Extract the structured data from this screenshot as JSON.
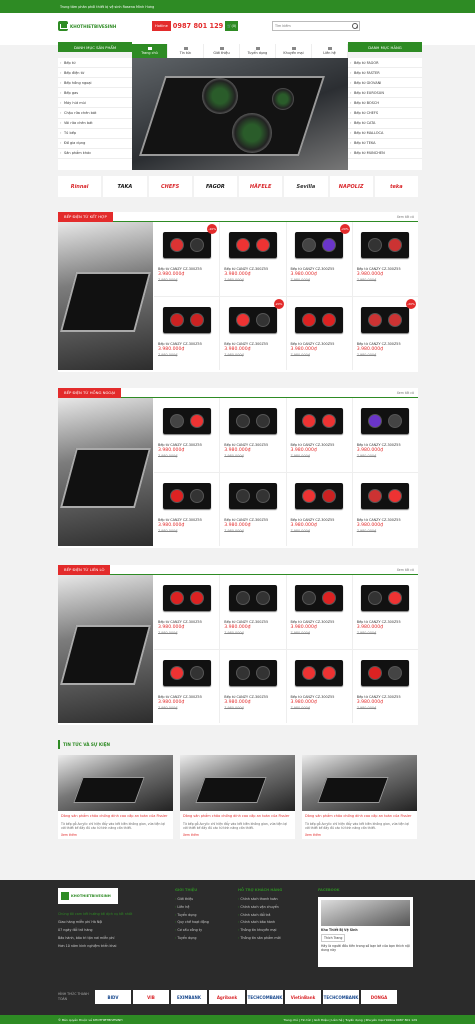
{
  "topbar": {
    "text": "Trung tâm phân phối thiết bị vệ sinh Rosena Minh Hưng"
  },
  "header": {
    "logo": "KHOTHIETBIVESINH",
    "hotline_label": "Hotline",
    "hotline_number": "0987 801 129",
    "cart_count": "(0)",
    "search_placeholder": "Tìm kiếm"
  },
  "nav": {
    "left_title": "DANH MỤC SẢN PHẨM",
    "right_title": "DANH MỤC HÃNG",
    "items": [
      "Trang chủ",
      "Tin tức",
      "Giới thiệu",
      "Tuyển dụng",
      "Khuyến mại",
      "Liên hệ"
    ]
  },
  "left_menu": [
    "Bếp từ",
    "Bếp điện từ",
    "Bếp hồng ngoại",
    "Bếp gas",
    "Máy hút mùi",
    "Chậu rửa chén bát",
    "Vòi rửa chén bát",
    "Tủ bếp",
    "Đồ gia dụng",
    "Sản phẩm khác"
  ],
  "right_menu": [
    "Bếp từ FAGOR",
    "Bếp từ FASTER",
    "Bếp từ GIOVANI",
    "Bếp từ EUROSUN",
    "Bếp từ BOSCH",
    "Bếp từ CHEFS",
    "Bếp từ CATA",
    "Bếp từ MALLOCA",
    "Bếp từ TEKA",
    "Bếp từ MUNCHEN"
  ],
  "brands": [
    {
      "name": "Rinnai",
      "color": "#d9262a"
    },
    {
      "name": "TAKA",
      "color": "#111111"
    },
    {
      "name": "CHEFS",
      "color": "#d9262a"
    },
    {
      "name": "FAGOR",
      "color": "#111111"
    },
    {
      "name": "HÄFELE",
      "color": "#d9262a"
    },
    {
      "name": "Sevilla",
      "color": "#333333"
    },
    {
      "name": "NAPOLIZ",
      "color": "#d9262a"
    },
    {
      "name": "teka",
      "color": "#d9262a"
    }
  ],
  "sections": [
    {
      "title": "BẾP ĐIỆN TỪ KẾT HỢP",
      "more": "Xem tất cả",
      "products": [
        {
          "name": "Bếp từ CANZY CZ-300Z55",
          "price": "3.980.000₫",
          "old": "7.980.000₫",
          "sale": "-20%",
          "zones": [
            "#d33",
            "#333"
          ]
        },
        {
          "name": "Bếp từ CANZY CZ-300Z55",
          "price": "3.980.000₫",
          "old": "7.980.000₫",
          "sale": "",
          "zones": [
            "#e33",
            "#e33"
          ]
        },
        {
          "name": "Bếp từ CANZY CZ-300Z55",
          "price": "3.980.000₫",
          "old": "7.980.000₫",
          "sale": "-20%",
          "zones": [
            "#444",
            "#6a35c9"
          ]
        },
        {
          "name": "Bếp từ CANZY CZ-300Z55",
          "price": "3.980.000₫",
          "old": "7.980.000₫",
          "sale": "",
          "zones": [
            "#333",
            "#c33"
          ]
        },
        {
          "name": "Bếp từ CANZY CZ-300Z55",
          "price": "3.980.000₫",
          "old": "7.980.000₫",
          "sale": "",
          "zones": [
            "#c22",
            "#c22"
          ]
        },
        {
          "name": "Bếp từ CANZY CZ-300Z55",
          "price": "3.980.000₫",
          "old": "7.980.000₫",
          "sale": "-20%",
          "zones": [
            "#e33",
            "#333"
          ]
        },
        {
          "name": "Bếp từ CANZY CZ-300Z55",
          "price": "3.980.000₫",
          "old": "7.980.000₫",
          "sale": "",
          "zones": [
            "#d22",
            "#d22"
          ]
        },
        {
          "name": "Bếp từ CANZY CZ-300Z55",
          "price": "3.980.000₫",
          "old": "7.980.000₫",
          "sale": "-20%",
          "zones": [
            "#c33",
            "#c33"
          ]
        }
      ]
    },
    {
      "title": "BẾP ĐIỆN TỪ HỒNG NGOẠI",
      "more": "Xem tất cả",
      "products": [
        {
          "name": "Bếp từ CANZY CZ-300Z55",
          "price": "3.980.000₫",
          "old": "7.980.000₫",
          "sale": "",
          "zones": [
            "#444",
            "#e33"
          ]
        },
        {
          "name": "Bếp từ CANZY CZ-300Z55",
          "price": "3.980.000₫",
          "old": "7.980.000₫",
          "sale": "",
          "zones": [
            "#333",
            "#333"
          ]
        },
        {
          "name": "Bếp từ CANZY CZ-300Z55",
          "price": "3.980.000₫",
          "old": "7.980.000₫",
          "sale": "",
          "zones": [
            "#e33",
            "#e33"
          ]
        },
        {
          "name": "Bếp từ CANZY CZ-300Z55",
          "price": "3.980.000₫",
          "old": "7.980.000₫",
          "sale": "",
          "zones": [
            "#6a35c9",
            "#444"
          ]
        },
        {
          "name": "Bếp từ CANZY CZ-300Z55",
          "price": "3.980.000₫",
          "old": "7.980.000₫",
          "sale": "",
          "zones": [
            "#d22",
            "#333"
          ]
        },
        {
          "name": "Bếp từ CANZY CZ-300Z55",
          "price": "3.980.000₫",
          "old": "7.980.000₫",
          "sale": "",
          "zones": [
            "#333",
            "#333"
          ]
        },
        {
          "name": "Bếp từ CANZY CZ-300Z55",
          "price": "3.980.000₫",
          "old": "7.980.000₫",
          "sale": "",
          "zones": [
            "#e33",
            "#c22"
          ]
        },
        {
          "name": "Bếp từ CANZY CZ-300Z55",
          "price": "3.980.000₫",
          "old": "7.980.000₫",
          "sale": "",
          "zones": [
            "#c33",
            "#e33"
          ]
        }
      ]
    },
    {
      "title": "BẾP ĐIỆN TỪ LIÊN LÒ",
      "more": "Xem tất cả",
      "products": [
        {
          "name": "Bếp từ CANZY CZ-300Z55",
          "price": "3.980.000₫",
          "old": "7.980.000₫",
          "sale": "",
          "zones": [
            "#d22",
            "#d22"
          ]
        },
        {
          "name": "Bếp từ CANZY CZ-300Z55",
          "price": "3.980.000₫",
          "old": "7.980.000₫",
          "sale": "",
          "zones": [
            "#333",
            "#333"
          ]
        },
        {
          "name": "Bếp từ CANZY CZ-300Z55",
          "price": "3.980.000₫",
          "old": "7.980.000₫",
          "sale": "",
          "zones": [
            "#333",
            "#d22"
          ]
        },
        {
          "name": "Bếp từ CANZY CZ-300Z55",
          "price": "3.980.000₫",
          "old": "7.980.000₫",
          "sale": "",
          "zones": [
            "#333",
            "#e33"
          ]
        },
        {
          "name": "Bếp từ CANZY CZ-300Z55",
          "price": "3.980.000₫",
          "old": "7.980.000₫",
          "sale": "",
          "zones": [
            "#e33",
            "#333"
          ]
        },
        {
          "name": "Bếp từ CANZY CZ-300Z55",
          "price": "3.980.000₫",
          "old": "7.980.000₫",
          "sale": "",
          "zones": [
            "#333",
            "#333"
          ]
        },
        {
          "name": "Bếp từ CANZY CZ-300Z55",
          "price": "3.980.000₫",
          "old": "7.980.000₫",
          "sale": "",
          "zones": [
            "#e33",
            "#e33"
          ]
        },
        {
          "name": "Bếp từ CANZY CZ-300Z55",
          "price": "3.980.000₫",
          "old": "7.980.000₫",
          "sale": "",
          "zones": [
            "#d22",
            "#444"
          ]
        }
      ]
    }
  ],
  "news": {
    "title": "TIN TỨC VÀ SỰ KIỆN",
    "items": [
      {
        "title": "Dòng sản phẩm chảo chống dính cao cấp an toàn của Fissler",
        "desc": "Từ bếp gỗ Acrylic chỉ hiện đẩy vào kết kiên không gian, vừa tiện lợi với thiết kế đẩy đủ các từ tính năng cần thiết.",
        "more": "Xem thêm"
      },
      {
        "title": "Dòng sản phẩm chảo chống dính cao cấp an toàn của Fissler",
        "desc": "Từ bếp gỗ Acrylic chỉ hiện đẩy vào kết kiên không gian, vừa tiện lợi với thiết kế đẩy đủ các từ tính năng cần thiết.",
        "more": "Xem thêm"
      },
      {
        "title": "Dòng sản phẩm chảo chống dính cao cấp an toàn của Fissler",
        "desc": "Từ bếp gỗ Acrylic chỉ hiện đẩy vào kết kiên không gian, vừa tiện lợi với thiết kế đẩy đủ các từ tính năng cần thiết.",
        "more": "Xem thêm"
      }
    ]
  },
  "footer": {
    "intro": "Chúng tôi cam kết hướng tới dịch vụ tốt nhất",
    "bullets": [
      "Giao hàng miễn phí Hà Nội",
      "07 ngày đổi trả hàng",
      "Bảo hành, bảo trì tận nơi miễn phí",
      "Hơn 10 năm kinh nghiệm triển khai"
    ],
    "col2_title": "GIỚI THIỆU",
    "col2": [
      "Giới thiệu",
      "Liên hệ",
      "Tuyển dụng",
      "Quy chế hoạt động",
      "Cơ cấu công ty",
      "Tuyển dụng"
    ],
    "col3_title": "HỖ TRỢ KHÁCH HÀNG",
    "col3": [
      "Chính sách thanh toán",
      "Chính sách vận chuyển",
      "Chính sách đổi trả",
      "Chính sách bảo hành",
      "Thông tin khuyến mại",
      "Thông tin sản phẩm mới"
    ],
    "col4_title": "FACEBOOK",
    "fb_page": "Kho Thiết Bị Vệ Sinh",
    "fb_like": "Thích Trang",
    "fb_text": "Hãy là người đầu tiên trong số bạn bè của bạn thích nội dung này",
    "banks_label": "HÌNH THỨC THANH TOÁN",
    "banks": [
      "BIDV",
      "VIB",
      "EXIMBANK",
      "Agribank",
      "TECHCOMBANK",
      "VietinBank",
      "TECHCOMBANK",
      "DONGA"
    ],
    "copyright": "© Bản quyền thuộc về KHOTHIETBIVESINH",
    "bottom_links": "Trang chủ | Tin tức | Giới thiệu | Liên hệ | Tuyển dụng | Khuyến mại Hotline 0987 801 129"
  }
}
